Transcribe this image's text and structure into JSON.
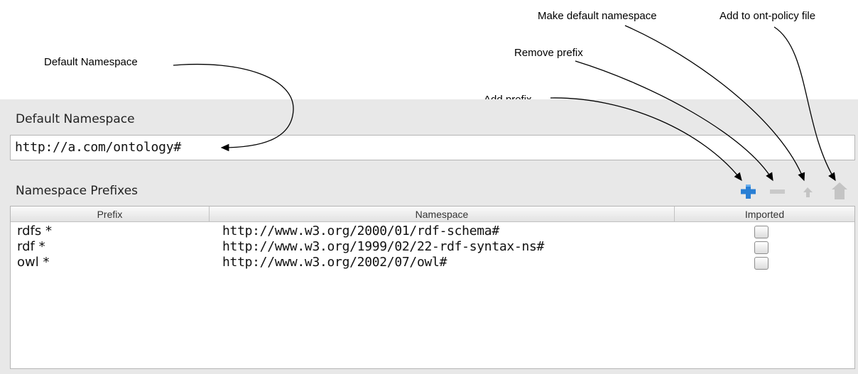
{
  "callouts": {
    "default_namespace": "Default Namespace",
    "add_prefix": "Add prefix",
    "remove_prefix": "Remove prefix",
    "make_default_namespace": "Make default namespace",
    "add_to_policy": "Add to ont-policy file"
  },
  "panel": {
    "default_namespace_title": "Default Namespace",
    "default_namespace_value": "http://a.com/ontology#",
    "prefixes_title": "Namespace Prefixes"
  },
  "toolbar": {
    "add_icon": "plus-icon",
    "remove_icon": "minus-icon",
    "make_default_icon": "small-arrow-up-icon",
    "policy_icon": "house-up-icon",
    "add_color": "#2a7fd4"
  },
  "table": {
    "columns": [
      "Prefix",
      "Namespace",
      "Imported"
    ],
    "rows": [
      {
        "prefix": "rdfs *",
        "namespace": "http://www.w3.org/2000/01/rdf-schema#",
        "imported": false
      },
      {
        "prefix": "rdf *",
        "namespace": "http://www.w3.org/1999/02/22-rdf-syntax-ns#",
        "imported": false
      },
      {
        "prefix": "owl *",
        "namespace": "http://www.w3.org/2002/07/owl#",
        "imported": false
      }
    ]
  }
}
